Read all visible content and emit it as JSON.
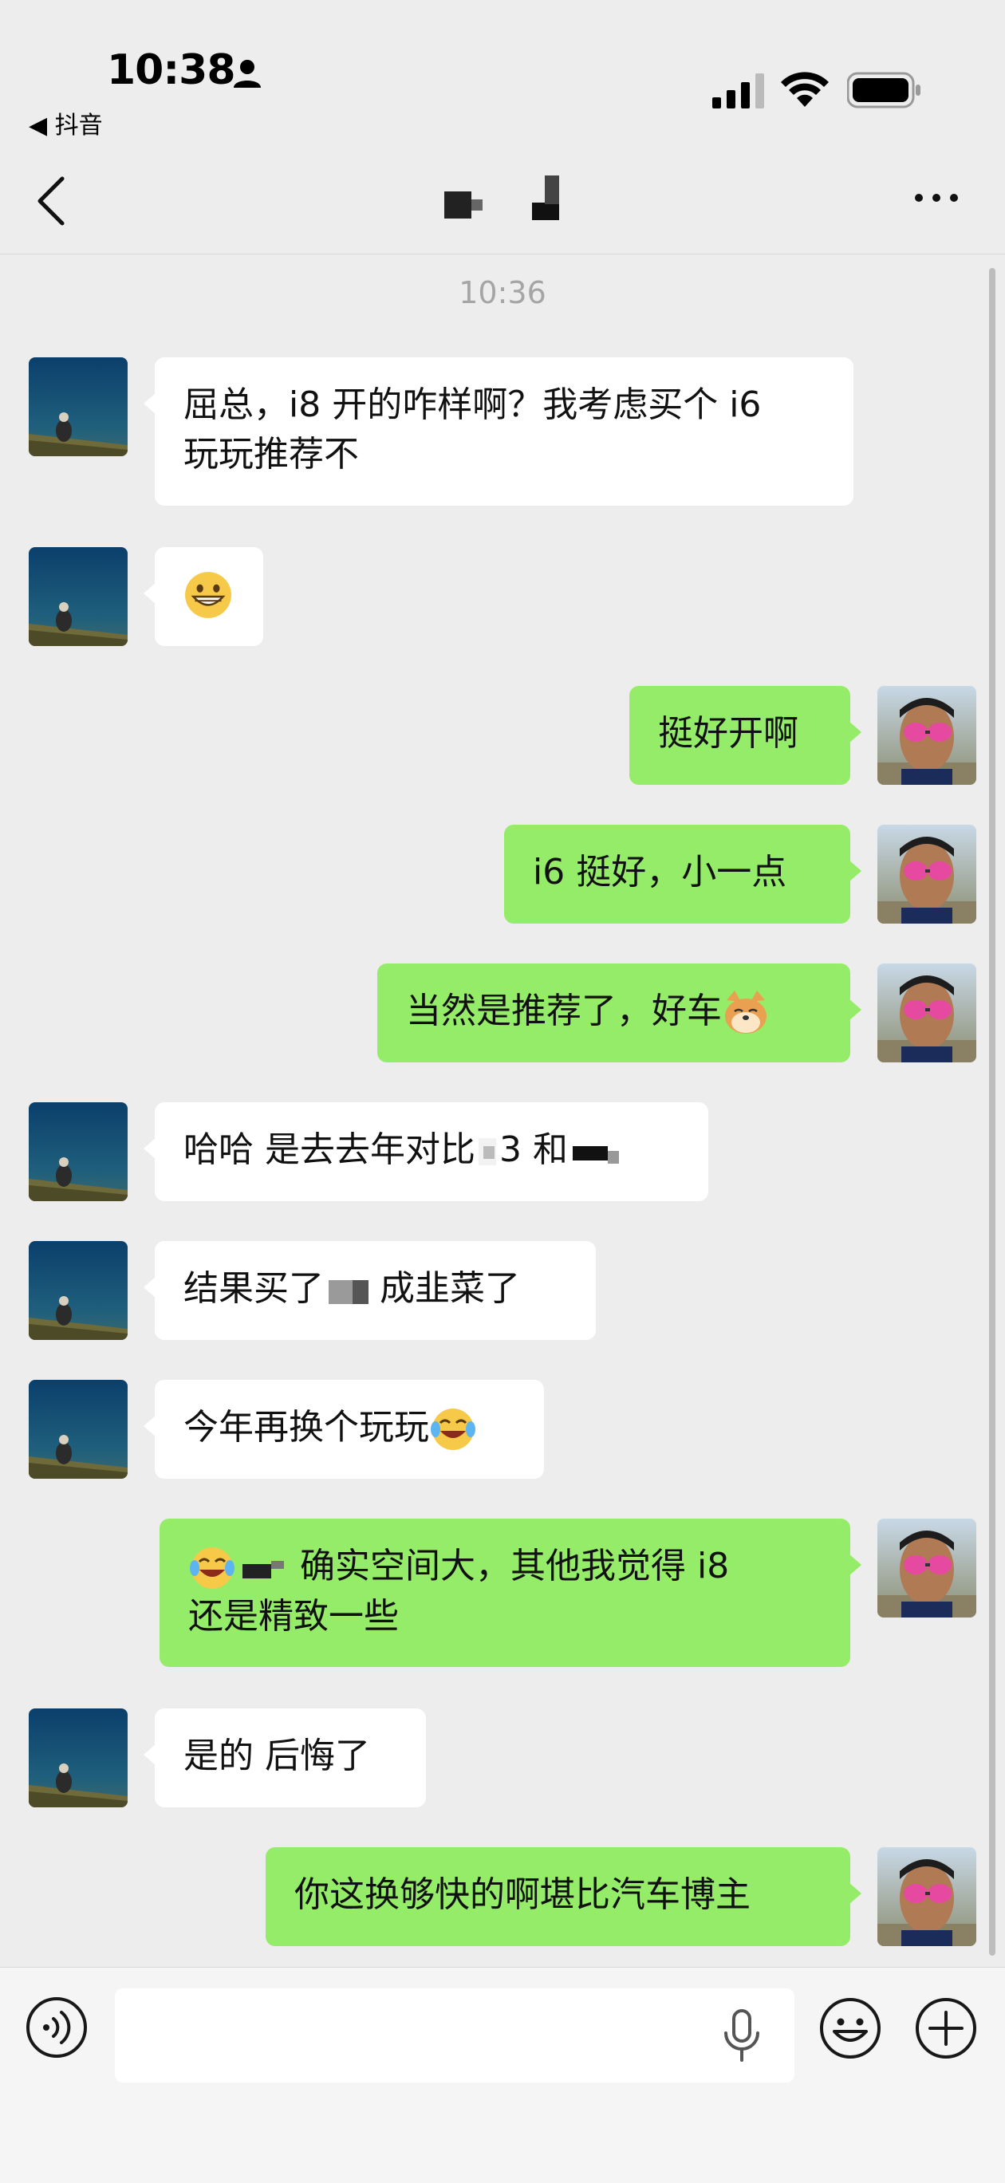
{
  "status_bar": {
    "time": "10:38",
    "back_app_label": "◀ 抖音"
  },
  "nav": {
    "back_icon": "chevron-left-icon",
    "more_icon": "ellipsis-icon",
    "title_redacted": true
  },
  "chat": {
    "timestamp": "10:36",
    "messages": [
      {
        "side": "left",
        "text": "屈总，i8 开的咋样啊？我考虑买个 i6",
        "text2": "玩玩推荐不"
      },
      {
        "side": "left",
        "emoji": "grinning-cat-face"
      },
      {
        "side": "right",
        "text": "挺好开啊"
      },
      {
        "side": "right",
        "text": "i6 挺好，小一点"
      },
      {
        "side": "right",
        "text": "当然是推荐了，好车",
        "emoji": "doge"
      },
      {
        "side": "left",
        "text_a": "哈哈 是去去年对比",
        "text_b": "3 和"
      },
      {
        "side": "left",
        "text_a": "结果买了",
        "text_b": "成韭菜了"
      },
      {
        "side": "left",
        "text": "今年再换个玩玩",
        "emoji": "tears-of-joy"
      },
      {
        "side": "right",
        "text_a": "确实空间大，其他我觉得 i8",
        "text2": "还是精致一些",
        "emoji": "tears-of-joy"
      },
      {
        "side": "left",
        "text": "是的 后悔了"
      },
      {
        "side": "right",
        "text": "你这换够快的啊堪比汽车博主"
      }
    ]
  },
  "input_bar": {
    "placeholder": "",
    "icons": [
      "voice-icon",
      "microphone-icon",
      "smiley-icon",
      "plus-icon"
    ]
  },
  "colors": {
    "background": "#ededed",
    "self_bubble": "#95ec69",
    "other_bubble": "#ffffff",
    "timestamp": "#a5a5a5"
  }
}
